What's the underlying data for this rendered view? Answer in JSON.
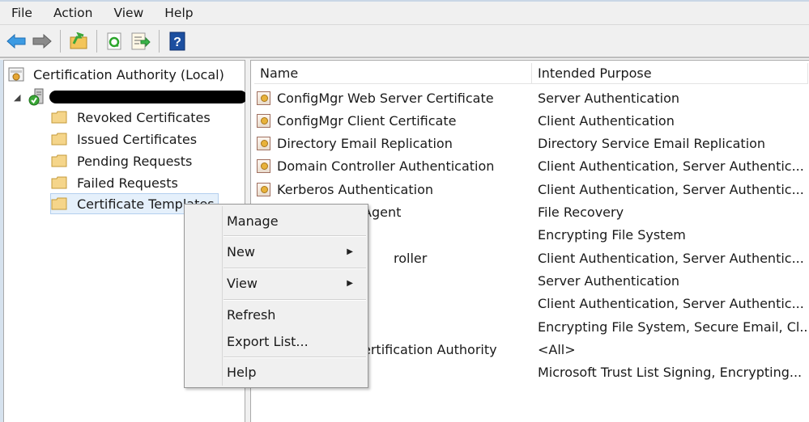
{
  "menubar": {
    "items": [
      "File",
      "Action",
      "View",
      "Help"
    ]
  },
  "toolbar": {
    "buttons": [
      {
        "name": "back-arrow-icon"
      },
      {
        "name": "forward-arrow-icon"
      },
      {
        "name": "up-level-folder-icon"
      },
      {
        "name": "refresh-icon"
      },
      {
        "name": "export-list-icon"
      },
      {
        "name": "help-icon",
        "glyph": "?"
      }
    ]
  },
  "tree": {
    "root": "Certification Authority (Local)",
    "server_name_redacted": true,
    "children": [
      "Revoked Certificates",
      "Issued Certificates",
      "Pending Requests",
      "Failed Requests",
      "Certificate Templates"
    ],
    "selected": "Certificate Templates"
  },
  "list": {
    "columns": [
      "Name",
      "Intended Purpose"
    ],
    "rows": [
      {
        "name": "ConfigMgr Web Server Certificate",
        "purpose": "Server Authentication"
      },
      {
        "name": "ConfigMgr Client Certificate",
        "purpose": "Client Authentication"
      },
      {
        "name": "Directory Email Replication",
        "purpose": "Directory Service Email Replication"
      },
      {
        "name": "Domain Controller Authentication",
        "purpose": "Client Authentication, Server Authentic..."
      },
      {
        "name": "Kerberos Authentication",
        "purpose": "Client Authentication, Server Authentic..."
      },
      {
        "name": "Agent",
        "purpose": "File Recovery"
      },
      {
        "name": "",
        "purpose": "Encrypting File System"
      },
      {
        "name": "roller",
        "purpose": "Client Authentication, Server Authentic..."
      },
      {
        "name": "",
        "purpose": "Server Authentication"
      },
      {
        "name": "",
        "purpose": "Client Authentication, Server Authentic..."
      },
      {
        "name": "",
        "purpose": "Encrypting File System, Secure Email, Cl..."
      },
      {
        "name": "ertification Authority",
        "purpose": "<All>"
      },
      {
        "name": "",
        "purpose": "Microsoft Trust List Signing, Encrypting..."
      }
    ]
  },
  "context_menu": {
    "items": [
      {
        "label": "Manage",
        "highlighted": true,
        "submenu": false
      },
      {
        "label": "New",
        "submenu": true
      },
      {
        "label": "View",
        "submenu": true
      },
      {
        "label": "Refresh",
        "submenu": false
      },
      {
        "label": "Export List...",
        "submenu": false
      },
      {
        "label": "Help",
        "submenu": false
      }
    ],
    "highlight_color": "#f6f20a"
  }
}
